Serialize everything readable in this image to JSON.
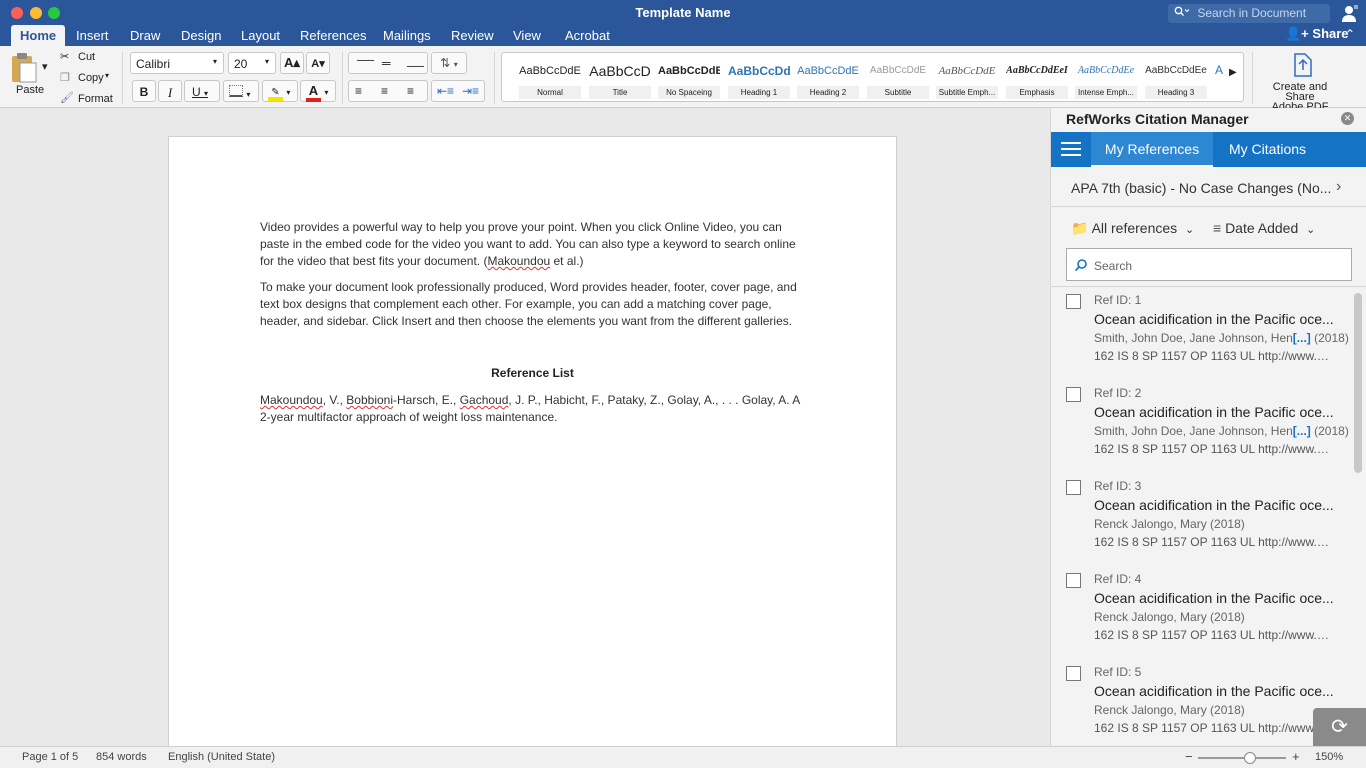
{
  "window": {
    "title": "Template Name",
    "search_placeholder": "Search in Document"
  },
  "ribbon_tabs": [
    "Home",
    "Insert",
    "Draw",
    "Design",
    "Layout",
    "References",
    "Mailings",
    "Review",
    "View",
    "Acrobat"
  ],
  "share_label": "Share",
  "clipboard": {
    "paste": "Paste",
    "cut": "Cut",
    "copy": "Copy",
    "format": "Format"
  },
  "font": {
    "name": "Calibri",
    "size": "20"
  },
  "styles": [
    {
      "preview": "AaBbCcDdE",
      "name": "Normal"
    },
    {
      "preview": "AaBbCcD",
      "name": "Title"
    },
    {
      "preview": "AaBbCcDdE",
      "name": "No Spaceing"
    },
    {
      "preview": "AaBbCcDd",
      "name": "Heading 1"
    },
    {
      "preview": "AaBbCcDdE",
      "name": "Heading 2"
    },
    {
      "preview": "AaBbCcDdE",
      "name": "Subtitle"
    },
    {
      "preview": "AaBbCcDdE",
      "name": "Subtitle Emph..."
    },
    {
      "preview": "AaBbCcDdEeI",
      "name": "Emphasis"
    },
    {
      "preview": "AaBbCcDdEe",
      "name": "Intense Emph..."
    },
    {
      "preview": "AaBbCcDdEe",
      "name": "Heading 3"
    }
  ],
  "style_partial": "A",
  "adobe": {
    "label_line1": "Create and Share",
    "label_line2": "Adobe PDF"
  },
  "document": {
    "para1_a": "Video provides a powerful way to help you prove your point. When you click Online Video, you can paste in the embed code for the video you want to add. You can also type a keyword to search online for the video that best fits your document.  (",
    "para1_cite": "Makoundou",
    "para1_b": " et al.)",
    "para2": "To make your document look professionally produced, Word provides header, footer, cover page, and text box designs that complement each other. For example, you can add a matching cover page, header, and sidebar. Click Insert and then choose the elements you want from the different galleries.",
    "ref_heading": "Reference List",
    "ref_author1": "Makoundou",
    "ref_mid1": ", V., ",
    "ref_author2": "Bobbioni",
    "ref_mid2": "-Harsch, E., ",
    "ref_author3": "Gachoud",
    "ref_rest": ", J. P., Habicht, F., Pataky, Z., Golay, A., . . . Golay, A. A 2-year multifactor approach of weight loss maintenance."
  },
  "panel": {
    "title": "RefWorks Citation Manager",
    "tab_refs": "My References",
    "tab_cites": "My Citations",
    "citation_style": "APA 7th (basic) - No Case Changes (No...",
    "filter_all": "All references",
    "filter_sort": "Date Added",
    "search_placeholder": "Search",
    "items": [
      {
        "id": "Ref ID: 1",
        "title": "Ocean acidification in the Pacific oce...",
        "authors": "Smith, John Doe, Jane Johnson, Hen",
        "more": "[...]",
        "year": " (2018)",
        "detail": "162 IS 8 SP 1157 OP 1163 UL http://www.cmaj..."
      },
      {
        "id": "Ref ID: 2",
        "title": "Ocean acidification in the Pacific oce...",
        "authors": "Smith, John Doe, Jane Johnson, Hen",
        "more": "[...]",
        "year": " (2018)",
        "detail": "162 IS 8 SP 1157 OP 1163 UL http://www.cmaj..."
      },
      {
        "id": "Ref ID: 3",
        "title": "Ocean acidification in the Pacific oce...",
        "authors": "Renck Jalongo, Mary (2018)",
        "more": "",
        "year": "",
        "detail": "162 IS 8 SP 1157 OP 1163 UL http://www.cmaj..."
      },
      {
        "id": "Ref ID: 4",
        "title": "Ocean acidification in the Pacific oce...",
        "authors": "Renck Jalongo, Mary (2018)",
        "more": "",
        "year": "",
        "detail": "162 IS 8 SP 1157 OP 1163 UL http://www.cmaj..."
      },
      {
        "id": "Ref ID: 5",
        "title": "Ocean acidification in the Pacific oce...",
        "authors": "Renck Jalongo, Mary (2018)",
        "more": "",
        "year": "",
        "detail": "162 IS 8 SP 1157 OP 1163 UL http://www.cmaj..."
      }
    ]
  },
  "status": {
    "page": "Page 1 of 5",
    "words": "854 words",
    "language": "English (United State)",
    "zoom": "150%",
    "zoom_minus": "−",
    "zoom_plus": "+"
  },
  "colors": {
    "word_blue": "#2b579a",
    "refworks_blue": "#1473c4"
  }
}
